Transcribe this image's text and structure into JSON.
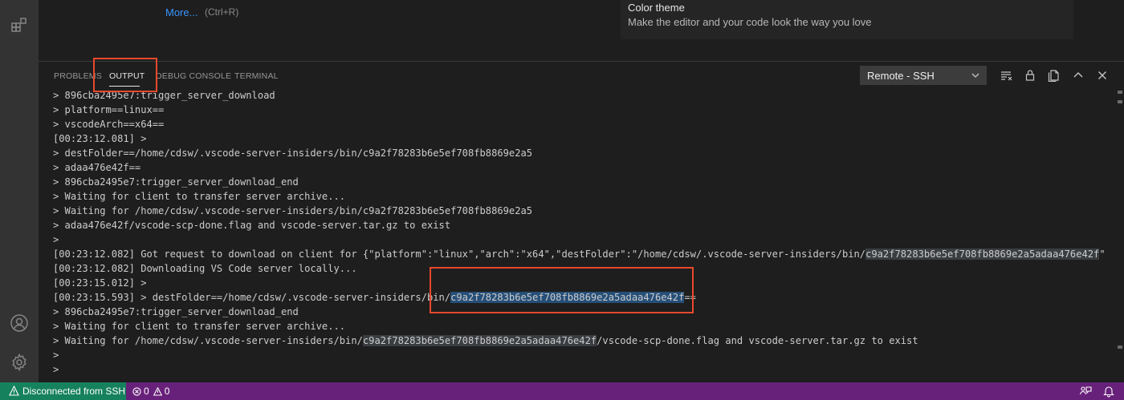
{
  "colors": {
    "activity_bar": "#333333",
    "editor_bg": "#1e1e1e",
    "status_bar": "#68217a",
    "remote_indicator": "#16825d",
    "selection": "#264f78",
    "annotation": "#e8492c",
    "link": "#3794ff"
  },
  "editor": {
    "more_link": "More...",
    "more_shortcut": "(Ctrl+R)",
    "theme_card": {
      "title": "Color theme",
      "description": "Make the editor and your code look the way you love"
    }
  },
  "panel": {
    "tabs": [
      {
        "label": "PROBLEMS",
        "active": false
      },
      {
        "label": "OUTPUT",
        "active": true
      },
      {
        "label": "DEBUG CONSOLE",
        "active": false
      },
      {
        "label": "TERMINAL",
        "active": false
      }
    ],
    "channel": "Remote - SSH",
    "toolbar_icons": [
      "clear-output-icon",
      "lock-scroll-icon",
      "open-log-icon",
      "maximize-panel-icon",
      "close-panel-icon"
    ]
  },
  "output": {
    "lines": [
      {
        "pre": "> 896cba2495e7:trigger_server_download"
      },
      {
        "pre": "> platform==linux=="
      },
      {
        "pre": "> vscodeArch==x64=="
      },
      {
        "pre": "[00:23:12.081] >"
      },
      {
        "pre": "> destFolder==/home/cdsw/.vscode-server-insiders/bin/c9a2f78283b6e5ef708fb8869e2a5"
      },
      {
        "pre": "> adaa476e42f=="
      },
      {
        "pre": "> 896cba2495e7:trigger_server_download_end"
      },
      {
        "pre": "> Waiting for client to transfer server archive..."
      },
      {
        "pre": "> Waiting for /home/cdsw/.vscode-server-insiders/bin/c9a2f78283b6e5ef708fb8869e2a5"
      },
      {
        "pre": "> adaa476e42f/vscode-scp-done.flag and vscode-server.tar.gz to exist"
      },
      {
        "pre": ">"
      },
      {
        "pre": "[00:23:12.082] Got request to download on client for {\"platform\":\"linux\",\"arch\":\"x64\",\"destFolder\":\"/home/cdsw/.vscode-server-insiders/bin/",
        "occ": "c9a2f78283b6e5ef708fb8869e2a5adaa476e42f",
        "post": "\"}"
      },
      {
        "pre": "[00:23:12.082] Downloading VS Code server locally..."
      },
      {
        "pre": "[00:23:15.012] >"
      },
      {
        "pre": "[00:23:15.593] > destFolder==/home/cdsw/.vscode-server-insiders/bin/",
        "sel": "c9a2f78283b6e5ef708fb8869e2a5adaa476e42f",
        "post": "=="
      },
      {
        "pre": "> 896cba2495e7:trigger_server_download_end"
      },
      {
        "pre": "> Waiting for client to transfer server archive..."
      },
      {
        "pre": "> Waiting for /home/cdsw/.vscode-server-insiders/bin/",
        "occ": "c9a2f78283b6e5ef708fb8869e2a5adaa476e42f",
        "post": "/vscode-scp-done.flag and vscode-server.tar.gz to exist"
      },
      {
        "pre": ">"
      },
      {
        "pre": ">"
      },
      {
        "pre": ">"
      }
    ]
  },
  "status_bar": {
    "remote_label": "Disconnected from SSH",
    "errors": "0",
    "warnings": "0"
  }
}
